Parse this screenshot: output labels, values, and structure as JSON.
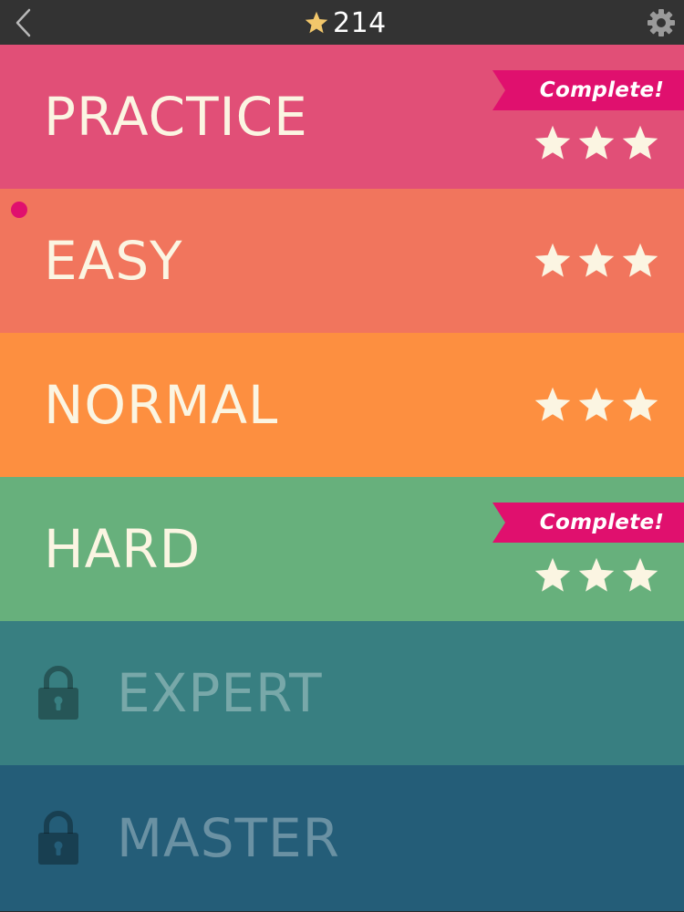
{
  "header": {
    "star_total": "214",
    "back_icon": "chevron-left-icon",
    "star_icon": "star-icon",
    "settings_icon": "gear-icon"
  },
  "colors": {
    "topbar": "#333333",
    "star_gold": "#f2c76b",
    "badge": "#e0106e",
    "dot": "#e0106e",
    "level_text": "#fbf5e2",
    "star_fill": "#fbf5e2"
  },
  "levels": [
    {
      "name": "PRACTICE",
      "color": "#e14f77",
      "stars": 3,
      "badge": "Complete!",
      "locked": false,
      "current": false
    },
    {
      "name": "EASY",
      "color": "#f1755d",
      "stars": 3,
      "badge": "",
      "locked": false,
      "current": true
    },
    {
      "name": "NORMAL",
      "color": "#fd8f40",
      "stars": 3,
      "badge": "",
      "locked": false,
      "current": false
    },
    {
      "name": "HARD",
      "color": "#67b07c",
      "stars": 3,
      "badge": "Complete!",
      "locked": false,
      "current": false
    },
    {
      "name": "EXPERT",
      "color": "#387f81",
      "stars": 0,
      "badge": "",
      "locked": true,
      "current": false
    },
    {
      "name": "MASTER",
      "color": "#245d78",
      "stars": 0,
      "badge": "",
      "locked": true,
      "current": false
    }
  ]
}
